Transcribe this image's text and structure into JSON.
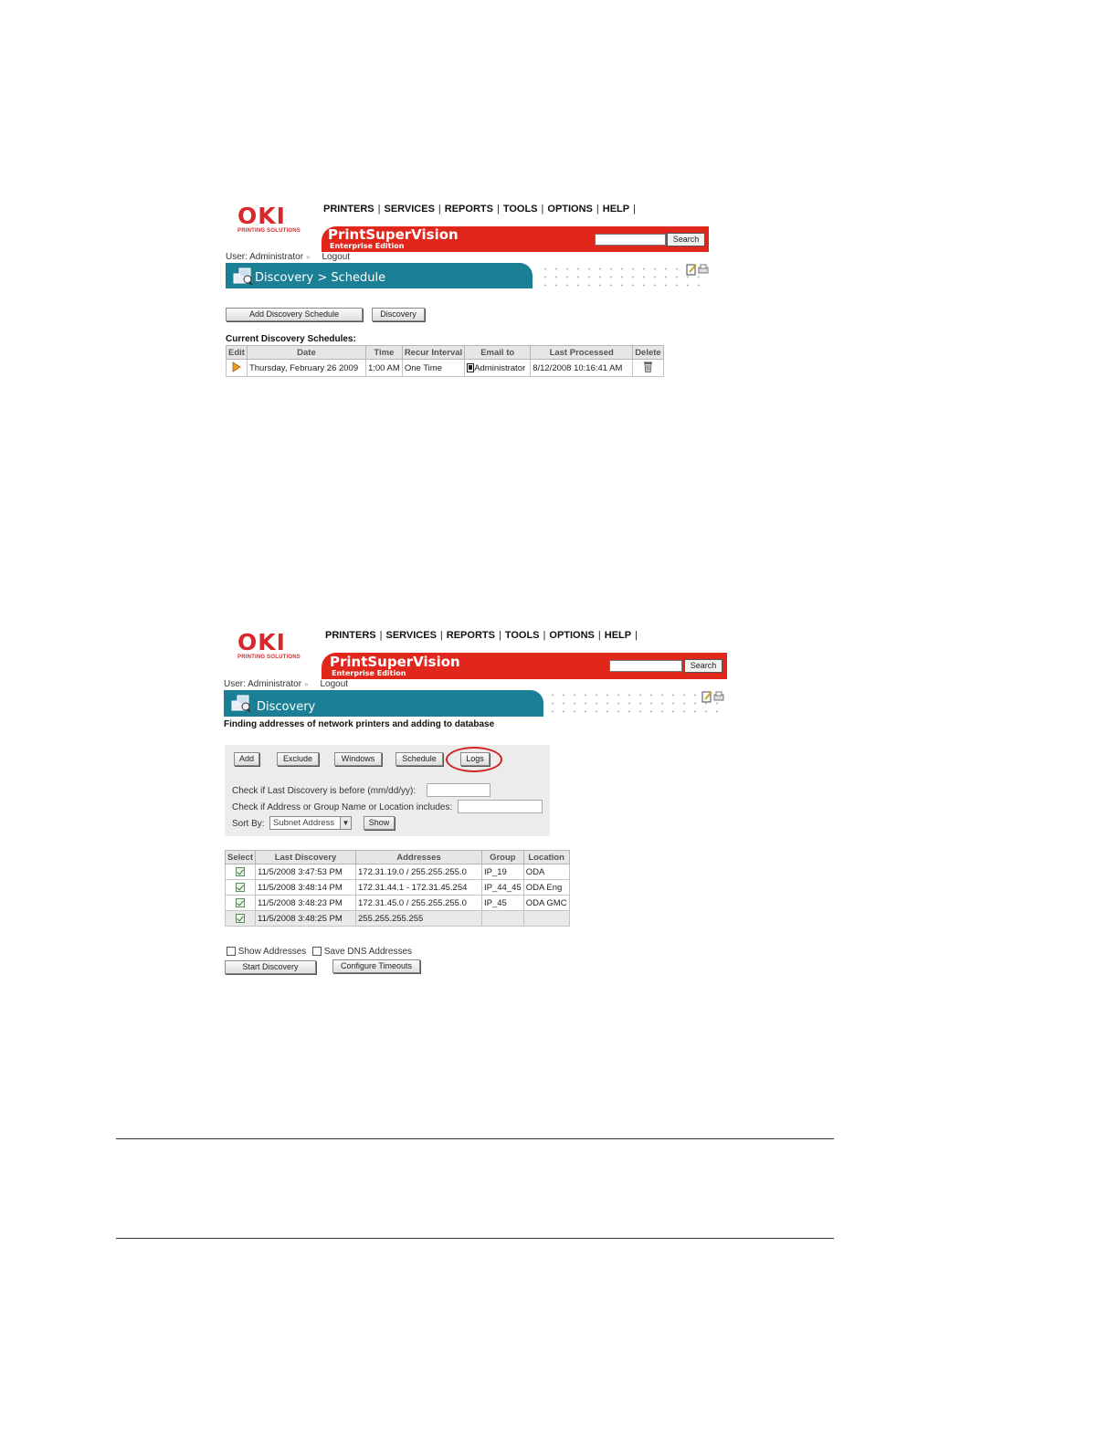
{
  "colors": {
    "brand_red": "#e1261c",
    "teal": "#1b7f96",
    "panel_gray": "#ececec",
    "highlight_circle": "#d42020"
  },
  "common": {
    "logo_word": "OKI",
    "logo_sub": "PRINTING SOLUTIONS",
    "nav": [
      "PRINTERS",
      "SERVICES",
      "REPORTS",
      "TOOLS",
      "OPTIONS",
      "HELP"
    ],
    "nav_sep": "|",
    "product": "PrintSuperVision",
    "edition": "Enterprise Edition",
    "search_button": "Search",
    "user_text": "User: Administrator",
    "logout": "Logout",
    "icons": [
      "reports-icon",
      "edit-page-icon",
      "print-icon"
    ]
  },
  "screen1": {
    "title": "Discovery > Schedule",
    "buttons": {
      "add_schedule": "Add Discovery Schedule",
      "discovery": "Discovery"
    },
    "section_label": "Current Discovery Schedules:",
    "table": {
      "headers": [
        "Edit",
        "Date",
        "Time",
        "Recur Interval",
        "Email to",
        "Last Processed",
        "Delete"
      ],
      "rows": [
        {
          "date": "Thursday, February 26 2009",
          "time": "1:00 AM",
          "recur": "One Time",
          "email": "Administrator",
          "last_processed": "8/12/2008 10:16:41 AM"
        }
      ]
    }
  },
  "screen2": {
    "title": "Discovery",
    "subtitle": "Finding addresses of network printers and adding to database",
    "buttons": {
      "add": "Add",
      "exclude": "Exclude",
      "windows": "Windows",
      "schedule": "Schedule",
      "logs": "Logs"
    },
    "filter": {
      "last_discovery_label": "Check if Last Discovery is before (mm/dd/yy):",
      "address_label": "Check if Address or Group Name or Location includes:",
      "sort_label": "Sort By:",
      "sort_value": "Subnet Address",
      "show_button": "Show"
    },
    "table": {
      "headers": [
        "Select",
        "Last Discovery",
        "Addresses",
        "Group",
        "Location"
      ],
      "rows": [
        {
          "checked": true,
          "last": "11/5/2008 3:47:53 PM",
          "address": "172.31.19.0 / 255.255.255.0",
          "group": "IP_19",
          "location": "ODA"
        },
        {
          "checked": true,
          "last": "11/5/2008 3:48:14 PM",
          "address": "172.31.44.1 - 172.31.45.254",
          "group": "IP_44_45",
          "location": "ODA Eng"
        },
        {
          "checked": true,
          "last": "11/5/2008 3:48:23 PM",
          "address": "172.31.45.0 / 255.255.255.0",
          "group": "IP_45",
          "location": "ODA GMC"
        },
        {
          "checked": true,
          "last": "11/5/2008 3:48:25 PM",
          "address": "255.255.255.255",
          "group": "",
          "location": ""
        }
      ]
    },
    "options": {
      "show_addresses": "Show Addresses",
      "save_dns": "Save DNS Addresses"
    },
    "actions": {
      "start": "Start Discovery",
      "configure": "Configure Timeouts"
    }
  }
}
